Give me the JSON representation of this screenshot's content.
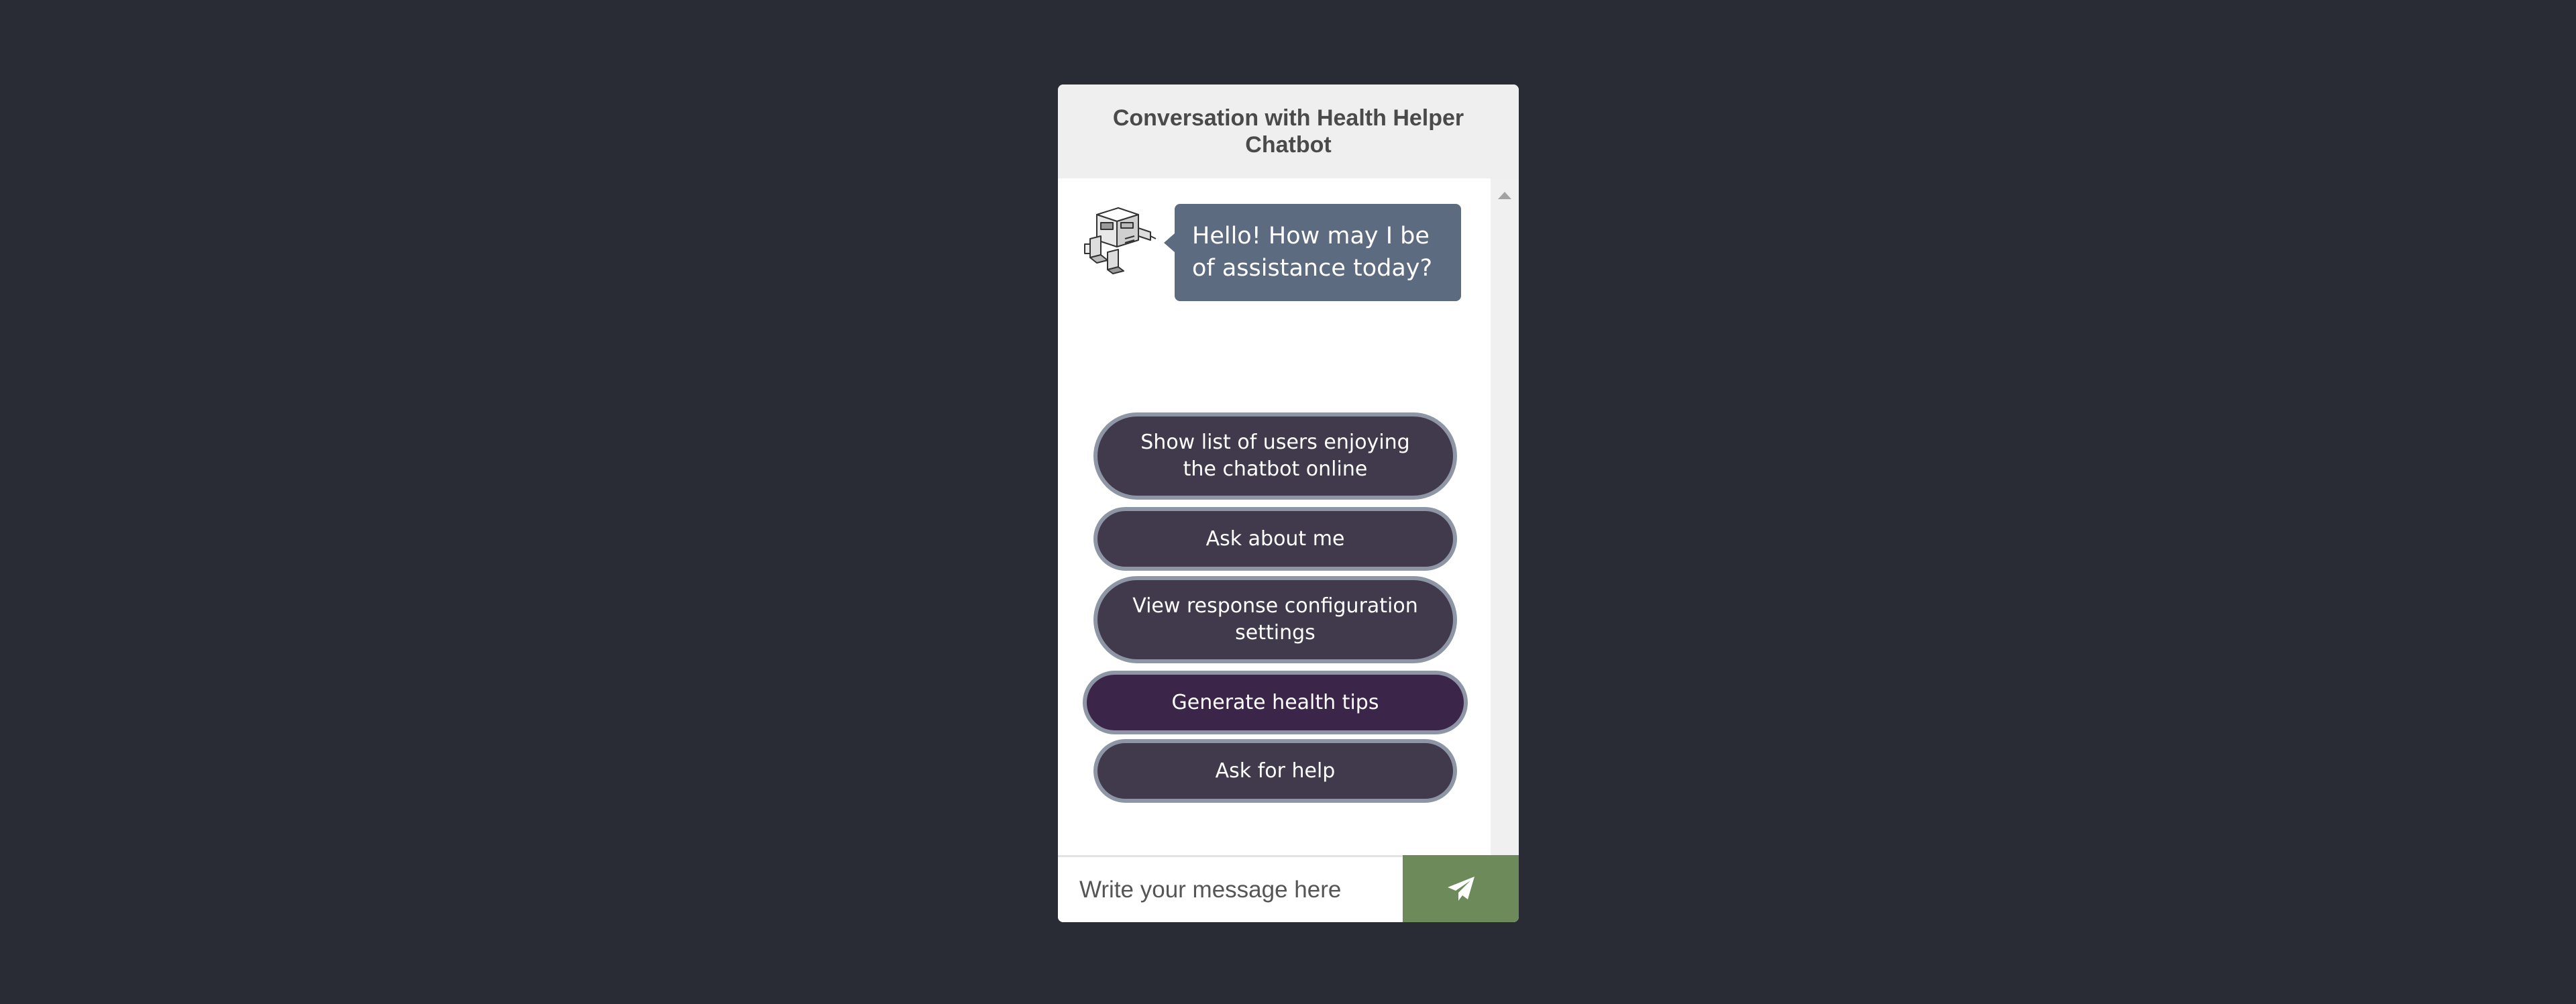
{
  "chat": {
    "title": "Conversation with Health Helper Chatbot",
    "bot_message": "Hello! How may I be of assistance today?",
    "options": [
      "Show list of users enjoying the chatbot online",
      "Ask about me",
      "View response configuration settings",
      "Generate health tips",
      "Ask for help"
    ],
    "input_placeholder": "Write your message here",
    "bot_avatar_icon": "robot-icon",
    "send_icon": "paper-plane-icon"
  },
  "colors": {
    "page_background": "#2a2c35",
    "header_background": "#efefef",
    "bot_bubble": "#5d6b80",
    "option_button": "#413a4c",
    "option_button_active": "#3b2548",
    "option_border": "#8e96a6",
    "send_button": "#6c8a5a"
  }
}
